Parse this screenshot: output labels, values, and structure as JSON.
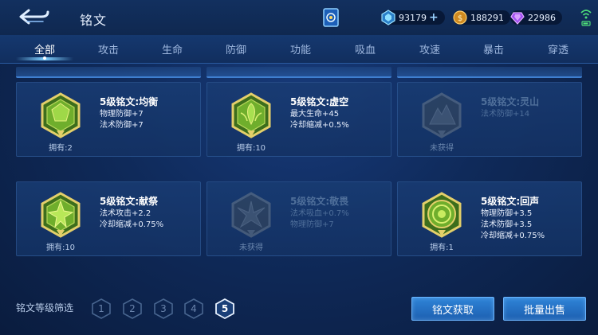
{
  "header": {
    "title": "铭文",
    "currencies": [
      {
        "name": "gem-diamond",
        "value": "93179",
        "color": "#6fc8ff"
      },
      {
        "name": "gold-coin",
        "value": "188291",
        "color": "#f0b040"
      },
      {
        "name": "purple-crystal",
        "value": "22986",
        "color": "#c070ff"
      }
    ]
  },
  "tabs": [
    {
      "label": "全部",
      "active": true
    },
    {
      "label": "攻击"
    },
    {
      "label": "生命"
    },
    {
      "label": "防御"
    },
    {
      "label": "功能"
    },
    {
      "label": "吸血"
    },
    {
      "label": "攻速"
    },
    {
      "label": "暴击"
    },
    {
      "label": "穿透"
    }
  ],
  "runes": [
    {
      "name": "5级铭文:均衡",
      "stats": [
        "物理防御+7",
        "法术防御+7"
      ],
      "owned": "拥有:2",
      "obtained": true,
      "icon": "balance-rune-icon"
    },
    {
      "name": "5级铭文:虚空",
      "stats": [
        "最大生命+45",
        "冷却缩减+0.5%"
      ],
      "owned": "拥有:10",
      "obtained": true,
      "icon": "void-rune-icon"
    },
    {
      "name": "5级铭文:灵山",
      "stats": [
        "法术防御+14"
      ],
      "owned": "未获得",
      "obtained": false,
      "icon": "spirit-mountain-rune-icon"
    },
    {
      "name": "5级铭文:献祭",
      "stats": [
        "法术攻击+2.2",
        "冷却缩减+0.75%"
      ],
      "owned": "拥有:10",
      "obtained": true,
      "icon": "sacrifice-rune-icon"
    },
    {
      "name": "5级铭文:敬畏",
      "stats": [
        "法术吸血+0.7%",
        "物理防御+7"
      ],
      "owned": "未获得",
      "obtained": false,
      "icon": "awe-rune-icon"
    },
    {
      "name": "5级铭文:回声",
      "stats": [
        "物理防御+3.5",
        "法术防御+3.5",
        "冷却缩减+0.75%"
      ],
      "owned": "拥有:1",
      "obtained": true,
      "icon": "echo-rune-icon"
    }
  ],
  "footer": {
    "filter_label": "铭文等级筛选",
    "levels": [
      "1",
      "2",
      "3",
      "4",
      "5"
    ],
    "active_level": "5",
    "get_button": "铭文获取",
    "sell_button": "批量出售"
  },
  "colors": {
    "accent": "#7fd0ff",
    "rune_gold": "#d9c060",
    "rune_green": "#5aa82c"
  }
}
